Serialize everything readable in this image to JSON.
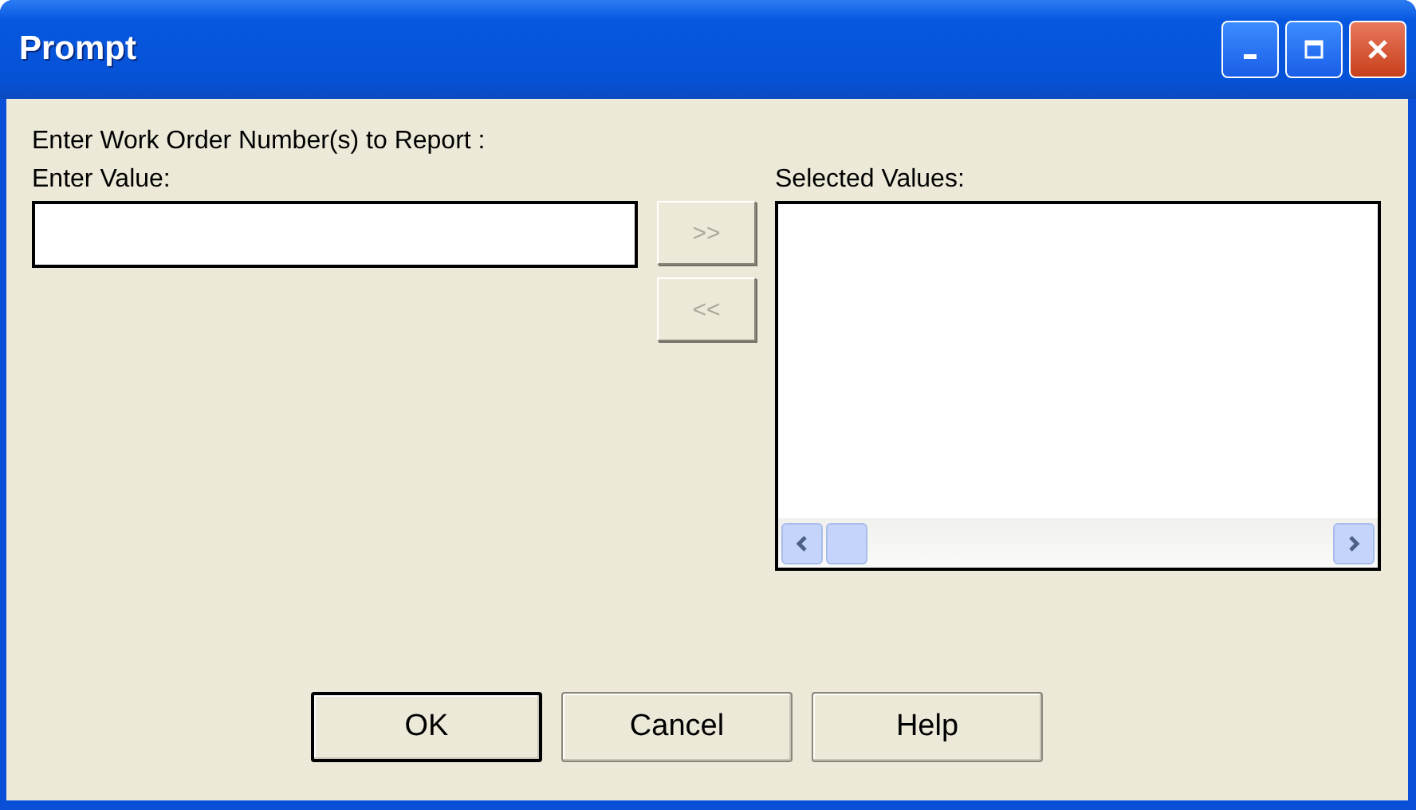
{
  "window": {
    "title": "Prompt"
  },
  "prompt": "Enter Work Order Number(s) to Report :",
  "value_field": {
    "label": "Enter Value:"
  },
  "move_buttons": [
    {
      "label": ">>",
      "disabled": true
    },
    {
      "label": "<<",
      "disabled": true
    }
  ],
  "selected_values": {
    "label": "Selected Values:"
  },
  "buttons": [
    {
      "label": "OK",
      "default": true
    },
    {
      "label": "Cancel",
      "default": false
    },
    {
      "label": "Help",
      "default": false
    }
  ]
}
